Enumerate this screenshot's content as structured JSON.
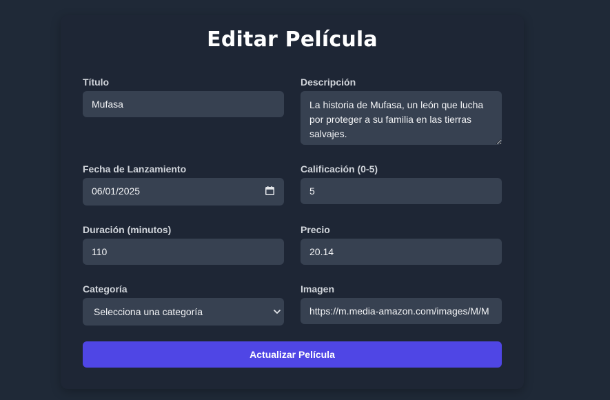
{
  "page": {
    "title": "Editar Película"
  },
  "form": {
    "titulo": {
      "label": "Título",
      "value": "Mufasa"
    },
    "descripcion": {
      "label": "Descripción",
      "value": "La historia de Mufasa, un león que lucha por proteger a su familia en las tierras salvajes."
    },
    "fecha": {
      "label": "Fecha de Lanzamiento",
      "value": "06/01/2025",
      "icon": "calendar-icon"
    },
    "calificacion": {
      "label": "Calificación (0-5)",
      "value": "5"
    },
    "duracion": {
      "label": "Duración (minutos)",
      "value": "110"
    },
    "precio": {
      "label": "Precio",
      "value": "20.14"
    },
    "categoria": {
      "label": "Categoría",
      "selected": "Selecciona una categoría",
      "icon": "chevron-down-icon"
    },
    "imagen": {
      "label": "Imagen",
      "value": "https://m.media-amazon.com/images/M/M"
    },
    "submit_label": "Actualizar Película"
  },
  "colors": {
    "background": "#1f2937",
    "card": "#1e2635",
    "field": "#374151",
    "accent": "#4f46e5"
  }
}
